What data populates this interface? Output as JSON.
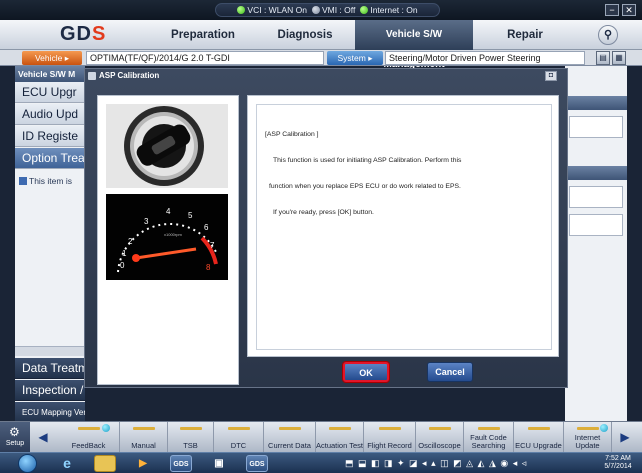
{
  "status": {
    "vci": "VCI : WLAN On",
    "vmi": "VMI : Off",
    "internet": "Internet : On"
  },
  "window_controls": {
    "minimize": "−",
    "close": "✕"
  },
  "nav": {
    "logo_main": "GD",
    "logo_accent": "S",
    "tabs": [
      "Preparation",
      "Diagnosis",
      "Vehicle S/W Management",
      "Repair"
    ],
    "active_tab": "Vehicle S/W Management"
  },
  "vehicle_row": {
    "vehicle_button": "Vehicle",
    "vehicle_value": "OPTIMA(TF/QF)/2014/G 2.0 T-GDI",
    "system_button": "System",
    "system_value": "Steering/Motor Driven Power Steering"
  },
  "left_panel": {
    "header": "Vehicle S/W M",
    "items": [
      "ECU Upgr",
      "Audio Upd",
      "ID Registe",
      "Option Treatr"
    ],
    "selected_index": 3,
    "note": "This item is",
    "bottom_items": [
      "Data Treatm",
      "Inspection / Test",
      "ECU Mapping Verification"
    ]
  },
  "dialog": {
    "title": "ASP Calibration",
    "message_heading": "[ASP Calibration ]",
    "message_line1": "This function is used for initiating ASP Calibration. Perform this",
    "message_line2": "function when you replace EPS ECU or do work related to EPS.",
    "message_line3": "If you're ready, press [OK] button.",
    "ok_label": "OK",
    "cancel_label": "Cancel",
    "gauge_caption": "x1000rpm"
  },
  "toolbar": {
    "setup_label": "Setup",
    "tools": [
      "FeedBack",
      "Manual",
      "TSB",
      "DTC",
      "Current Data",
      "Actuation Test",
      "Flight Record",
      "Oscilloscope",
      "Fault Code Searching",
      "ECU Upgrade",
      "Internet Update"
    ]
  },
  "taskbar": {
    "app1": "GDS",
    "app2": "GDS",
    "time": "7:52 AM",
    "date": "5/7/2014"
  },
  "colors": {
    "accent_orange": "#c95310",
    "accent_blue": "#2a67b2",
    "ok_highlight": "#e3152a",
    "status_led": "#3cba1a"
  }
}
